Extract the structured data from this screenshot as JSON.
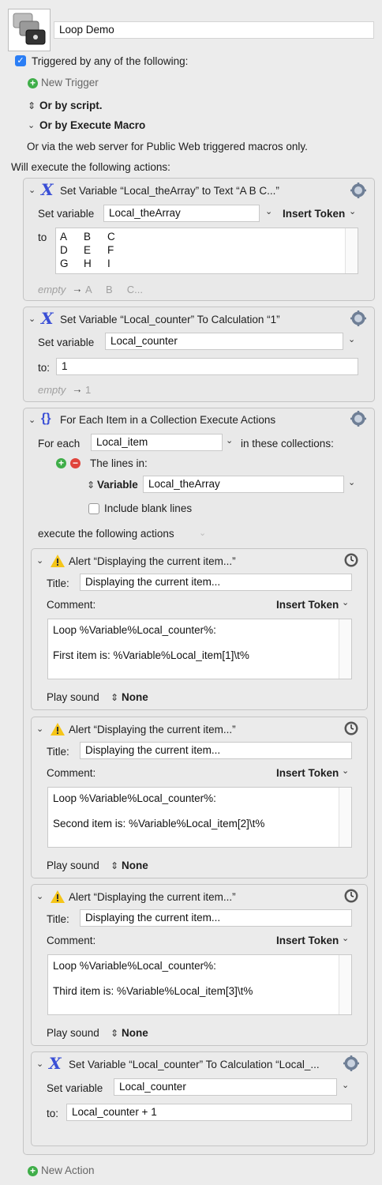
{
  "header": {
    "macro_name": "Loop Demo"
  },
  "triggers": {
    "checkbox_label": "Triggered by any of the following:",
    "new_trigger": "New Trigger",
    "or_by_script": "Or by script.",
    "or_by_execute_macro": "Or by Execute Macro",
    "web_server_note": "Or via the web server for Public Web triggered macros only."
  },
  "actions_heading": "Will execute the following actions:",
  "action1": {
    "title": "Set Variable “Local_theArray” to Text “A    B     C...”",
    "set_variable_label": "Set variable",
    "variable": "Local_theArray",
    "insert_token": "Insert Token",
    "to_label": "to",
    "grid": [
      [
        "A",
        "B",
        "C"
      ],
      [
        "D",
        "E",
        "F"
      ],
      [
        "G",
        "H",
        "I"
      ]
    ],
    "preview_empty": "empty",
    "preview_value": "A     B     C..."
  },
  "action2": {
    "title": "Set Variable “Local_counter” To Calculation “1”",
    "set_variable_label": "Set variable",
    "variable": "Local_counter",
    "to_label": "to:",
    "value": "1",
    "preview_empty": "empty",
    "preview_value": "1"
  },
  "action3": {
    "title": "For Each Item in a Collection Execute Actions",
    "for_each_label": "For each",
    "item_variable": "Local_item",
    "in_collections_label": "in these collections:",
    "lines_in_label": "The lines in:",
    "variable_label": "Variable",
    "collection_variable": "Local_theArray",
    "include_blank_label": "Include blank lines",
    "execute_label": "execute the following actions"
  },
  "alerts": [
    {
      "title": "Alert “Displaying the current item...”",
      "title_label": "Title:",
      "title_value": "Displaying the current item...",
      "comment_label": "Comment:",
      "insert_token": "Insert Token",
      "comment_line1": "Loop %Variable%Local_counter%:",
      "comment_line2": "First item is: %Variable%Local_item[1]\\t%",
      "play_sound_label": "Play sound",
      "sound": "None"
    },
    {
      "title": "Alert “Displaying the current item...”",
      "title_label": "Title:",
      "title_value": "Displaying the current item...",
      "comment_label": "Comment:",
      "insert_token": "Insert Token",
      "comment_line1": "Loop %Variable%Local_counter%:",
      "comment_line2": "Second item is: %Variable%Local_item[2]\\t%",
      "play_sound_label": "Play sound",
      "sound": "None"
    },
    {
      "title": "Alert “Displaying the current item...”",
      "title_label": "Title:",
      "title_value": "Displaying the current item...",
      "comment_label": "Comment:",
      "insert_token": "Insert Token",
      "comment_line1": "Loop %Variable%Local_counter%:",
      "comment_line2": "Third item is: %Variable%Local_item[3]\\t%",
      "play_sound_label": "Play sound",
      "sound": "None"
    }
  ],
  "action4": {
    "title": "Set Variable “Local_counter” To Calculation “Local_...",
    "set_variable_label": "Set variable",
    "variable": "Local_counter",
    "to_label": "to:",
    "value": "Local_counter + 1"
  },
  "new_action": "New Action",
  "colors": {
    "accent_blue": "#2b7ef5",
    "variable_icon": "#3a4fd6",
    "warning": "#f5c518",
    "add_green": "#3fae49",
    "remove_red": "#e0443c"
  }
}
